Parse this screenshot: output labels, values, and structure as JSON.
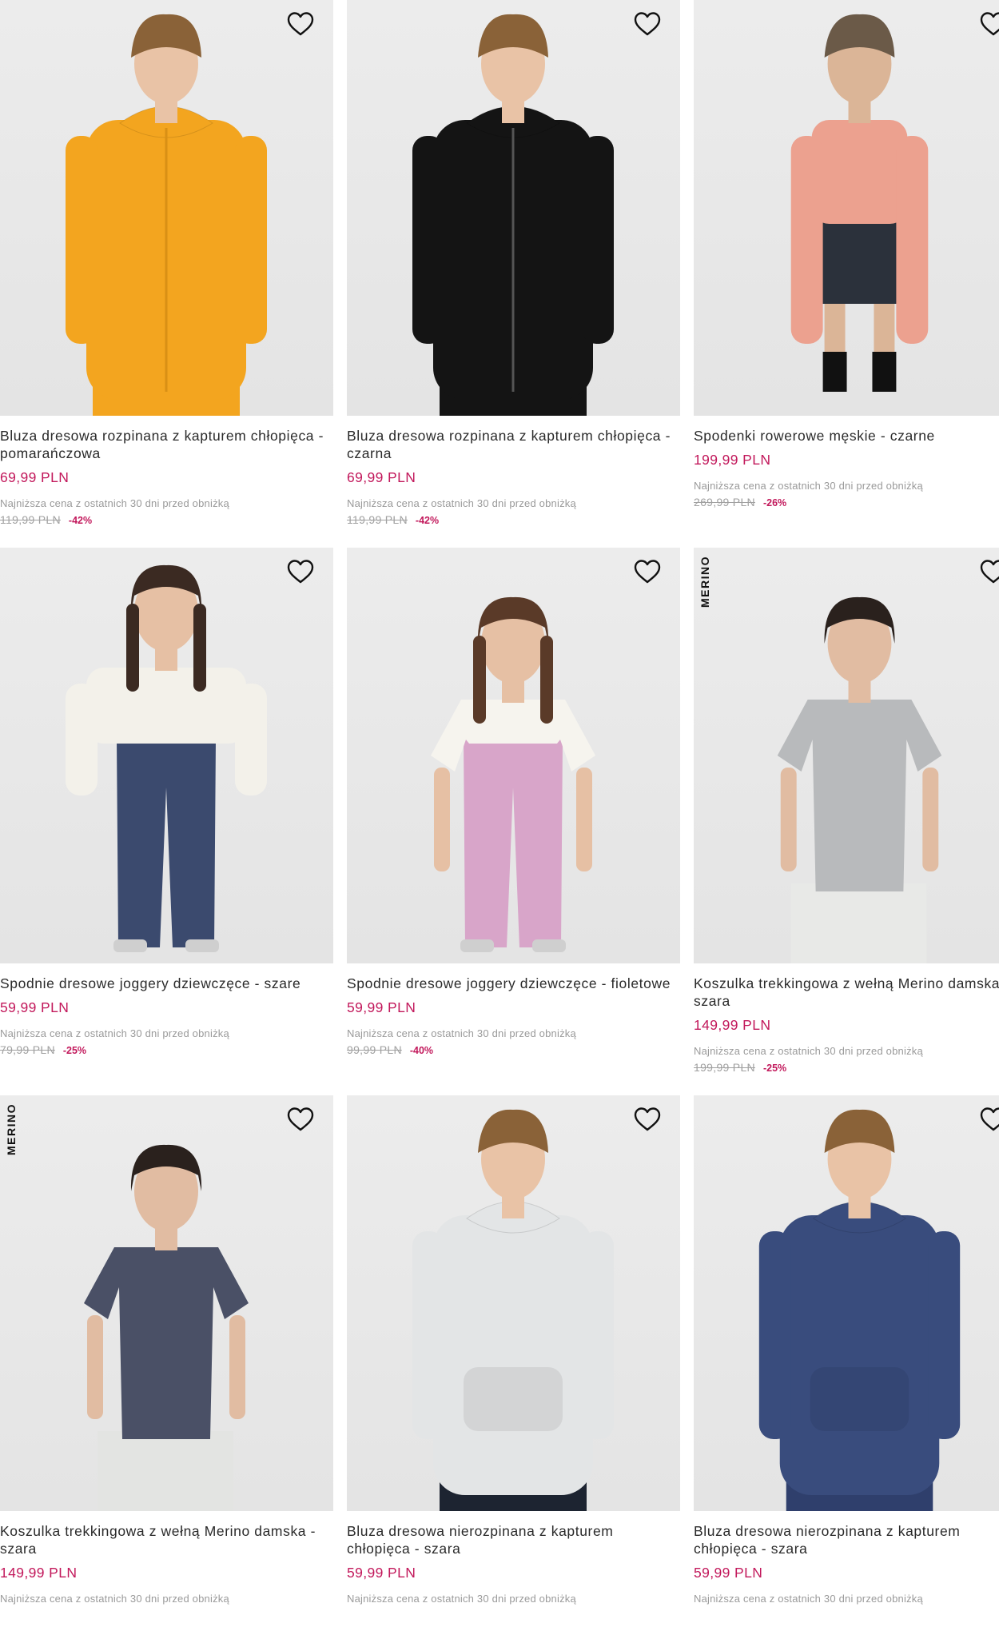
{
  "products": [
    {
      "title": "Bluza dresowa rozpinana z kapturem chłopięca - pomarańczowa",
      "price": "69,99 PLN",
      "lowest_note": "Najniższa cena z ostatnich 30 dni przed obniżką",
      "old_price": "119,99 PLN",
      "discount": "-42%",
      "badge": "",
      "figure": "orange-hoodie"
    },
    {
      "title": "Bluza dresowa rozpinana z kapturem chłopięca - czarna",
      "price": "69,99 PLN",
      "lowest_note": "Najniższa cena z ostatnich 30 dni przed obniżką",
      "old_price": "119,99 PLN",
      "discount": "-42%",
      "badge": "",
      "figure": "black-hoodie"
    },
    {
      "title": "Spodenki rowerowe męskie - czarne",
      "price": "199,99 PLN",
      "lowest_note": "Najniższa cena z ostatnich 30 dni przed obniżką",
      "old_price": "269,99 PLN",
      "discount": "-26%",
      "badge": "",
      "figure": "shorts-man"
    },
    {
      "title": "Spodnie dresowe joggery dziewczęce - szare",
      "price": "59,99 PLN",
      "lowest_note": "Najniższa cena z ostatnich 30 dni przed obniżką",
      "old_price": "79,99 PLN",
      "discount": "-25%",
      "badge": "",
      "figure": "navy-joggers"
    },
    {
      "title": "Spodnie dresowe joggery dziewczęce - fioletowe",
      "price": "59,99 PLN",
      "lowest_note": "Najniższa cena z ostatnich 30 dni przed obniżką",
      "old_price": "99,99 PLN",
      "discount": "-40%",
      "badge": "",
      "figure": "pink-joggers"
    },
    {
      "title": "Koszulka trekkingowa z wełną Merino damska - szara",
      "price": "149,99 PLN",
      "lowest_note": "Najniższa cena z ostatnich 30 dni przed obniżką",
      "old_price": "199,99 PLN",
      "discount": "-25%",
      "badge": "MERINO",
      "figure": "grey-tee"
    },
    {
      "title": "Koszulka trekkingowa z wełną Merino damska - szara",
      "price": "149,99 PLN",
      "lowest_note": "Najniższa cena z ostatnich 30 dni przed obniżką",
      "old_price": "",
      "discount": "",
      "badge": "MERINO",
      "figure": "navy-tee"
    },
    {
      "title": "Bluza dresowa nierozpinana z kapturem chłopięca - szara",
      "price": "59,99 PLN",
      "lowest_note": "Najniższa cena z ostatnich 30 dni przed obniżką",
      "old_price": "",
      "discount": "",
      "badge": "",
      "figure": "light-hoodie"
    },
    {
      "title": "Bluza dresowa nierozpinana z kapturem chłopięca - szara",
      "price": "59,99 PLN",
      "lowest_note": "Najniższa cena z ostatnich 30 dni przed obniżką",
      "old_price": "",
      "discount": "",
      "badge": "",
      "figure": "blue-hoodie"
    }
  ],
  "colors": {
    "price": "#c2185b",
    "image_bg": "#e8e8e8"
  },
  "icons": {
    "favorite": "heart-outline-icon"
  }
}
